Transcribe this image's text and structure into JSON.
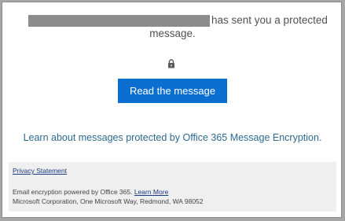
{
  "message": {
    "sender_text_suffix": "has sent you a protected",
    "line2": "message.",
    "lock_icon": "lock-icon",
    "read_button_label": "Read the message",
    "learn_link_text": "Learn about messages protected by Office 365 Message Encryption."
  },
  "footer": {
    "privacy_label": "Privacy Statement",
    "encryption_text": "Email encryption powered by Office 365.",
    "learn_more_label": "Learn More",
    "address": "Microsoft Corporation, One Microsoft Way, Redmond, WA 98052"
  },
  "colors": {
    "button_bg": "#0a6fd1",
    "link": "#2c6a8f",
    "footer_bg": "#efefef",
    "redaction": "#8c8c8c"
  }
}
